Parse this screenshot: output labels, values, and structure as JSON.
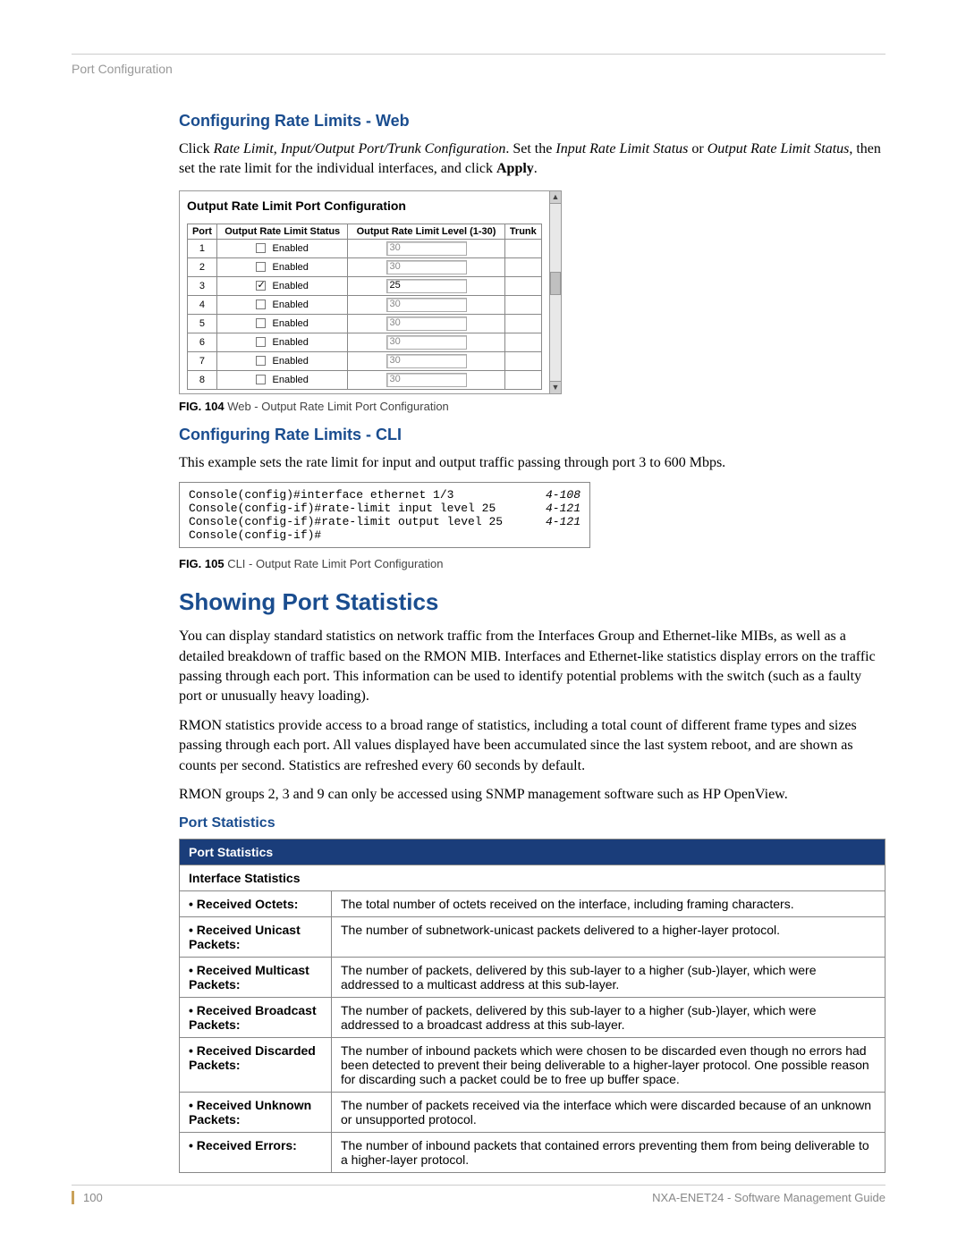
{
  "header": {
    "breadcrumb": "Port Configuration"
  },
  "section1": {
    "title": "Configuring Rate Limits - Web",
    "para_prefix": "Click ",
    "para_i1": "Rate Limit",
    "para_mid1": ", ",
    "para_i2": "Input/Output Port/Trunk Configuration",
    "para_mid2": ". Set the ",
    "para_i3": "Input Rate Limit Status",
    "para_mid3": " or ",
    "para_i4": "Output Rate Limit Status",
    "para_mid4": ", then set the rate limit for the individual interfaces, and click ",
    "para_b1": "Apply",
    "para_end": "."
  },
  "screenshot": {
    "title": "Output Rate Limit Port Configuration",
    "cols": {
      "port": "Port",
      "status": "Output Rate Limit Status",
      "level": "Output Rate Limit Level (1-30)",
      "trunk": "Trunk"
    },
    "enabled_label": "Enabled",
    "rows": [
      {
        "port": "1",
        "checked": false,
        "level": "30"
      },
      {
        "port": "2",
        "checked": false,
        "level": "30"
      },
      {
        "port": "3",
        "checked": true,
        "level": "25"
      },
      {
        "port": "4",
        "checked": false,
        "level": "30"
      },
      {
        "port": "5",
        "checked": false,
        "level": "30"
      },
      {
        "port": "6",
        "checked": false,
        "level": "30"
      },
      {
        "port": "7",
        "checked": false,
        "level": "30"
      },
      {
        "port": "8",
        "checked": false,
        "level": "30"
      }
    ]
  },
  "fig104": {
    "num": "FIG. 104",
    "text": "  Web - Output Rate Limit Port Configuration"
  },
  "section2": {
    "title": "Configuring Rate Limits - CLI",
    "para": "This example sets the rate limit for input and output traffic passing through port 3 to 600 Mbps."
  },
  "cli": {
    "lines": [
      {
        "cmd": "Console(config)#interface ethernet 1/3",
        "ref": "4-108"
      },
      {
        "cmd": "Console(config-if)#rate-limit input level 25",
        "ref": "4-121"
      },
      {
        "cmd": "Console(config-if)#rate-limit output level 25",
        "ref": "4-121"
      },
      {
        "cmd": "Console(config-if)#",
        "ref": ""
      }
    ]
  },
  "fig105": {
    "num": "FIG. 105",
    "text": "  CLI - Output Rate Limit Port Configuration"
  },
  "section3": {
    "title": "Showing Port Statistics",
    "p1": "You can display standard statistics on network traffic from the Interfaces Group and Ethernet-like MIBs, as well as a detailed breakdown of traffic based on the RMON MIB. Interfaces and Ethernet-like statistics display errors on the traffic passing through each port. This information can be used to identify potential problems with the switch (such as a faulty port or unusually heavy loading).",
    "p2": "RMON statistics provide access to a broad range of statistics, including a total count of different frame types and sizes passing through each port. All values displayed have been accumulated since the last system reboot, and are shown as counts per second. Statistics are refreshed every 60 seconds by default.",
    "p3": "RMON groups 2, 3 and 9 can only be accessed using SNMP management software such as HP OpenView."
  },
  "stats": {
    "heading": "Port Statistics",
    "table_header": "Port Statistics",
    "subheader": "Interface Statistics",
    "rows": [
      {
        "label": "• Received Octets:",
        "desc": "The total number of octets received on the interface, including framing characters."
      },
      {
        "label": "• Received Unicast Packets:",
        "desc": "The number of subnetwork-unicast packets delivered to a higher-layer protocol."
      },
      {
        "label": "• Received Multicast Packets:",
        "desc": "The number of packets, delivered by this sub-layer to a higher (sub-)layer, which were addressed to a multicast address at this sub-layer."
      },
      {
        "label": "• Received Broadcast Packets:",
        "desc": "The number of packets, delivered by this sub-layer to a higher (sub-)layer, which were addressed to a broadcast address at this sub-layer."
      },
      {
        "label": "• Received Discarded Packets:",
        "desc": "The number of inbound packets which were chosen to be discarded even though no errors had been detected to prevent their being deliverable to a higher-layer protocol. One possible reason for discarding such a packet could be to free up buffer space."
      },
      {
        "label": "• Received Unknown Packets:",
        "desc": "The number of packets received via the interface which were discarded because of an unknown or unsupported protocol."
      },
      {
        "label": "• Received Errors:",
        "desc": "The number of inbound packets that contained errors preventing them from being deliverable to a higher-layer protocol."
      }
    ]
  },
  "footer": {
    "page": "100",
    "doc": "NXA-ENET24 - Software Management Guide"
  }
}
